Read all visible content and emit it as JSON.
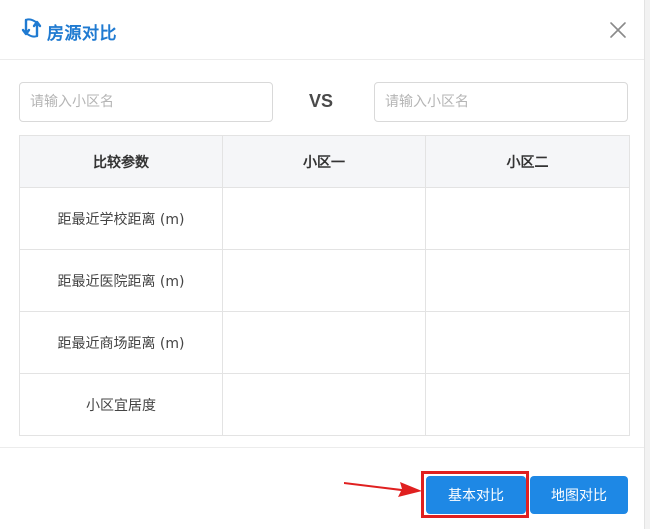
{
  "dialog": {
    "title": "房源对比",
    "title_icon": "compare-arrows-icon",
    "close_icon": "close-icon",
    "accent_color": "#1f7ad1"
  },
  "search": {
    "left_placeholder": "请输入小区名",
    "right_placeholder": "请输入小区名",
    "left_value": "",
    "right_value": "",
    "vs_label": "VS"
  },
  "table": {
    "headers": [
      "比较参数",
      "小区一",
      "小区二"
    ],
    "rows": [
      {
        "label": "距最近学校距离 (m)",
        "col1": "",
        "col2": ""
      },
      {
        "label": "距最近医院距离 (m)",
        "col1": "",
        "col2": ""
      },
      {
        "label": "距最近商场距离 (m)",
        "col1": "",
        "col2": ""
      },
      {
        "label": "小区宜居度",
        "col1": "",
        "col2": ""
      }
    ]
  },
  "footer": {
    "basic_compare_label": "基本对比",
    "map_compare_label": "地图对比",
    "button_color": "#1e88e5",
    "annotation_color": "#e02020"
  }
}
